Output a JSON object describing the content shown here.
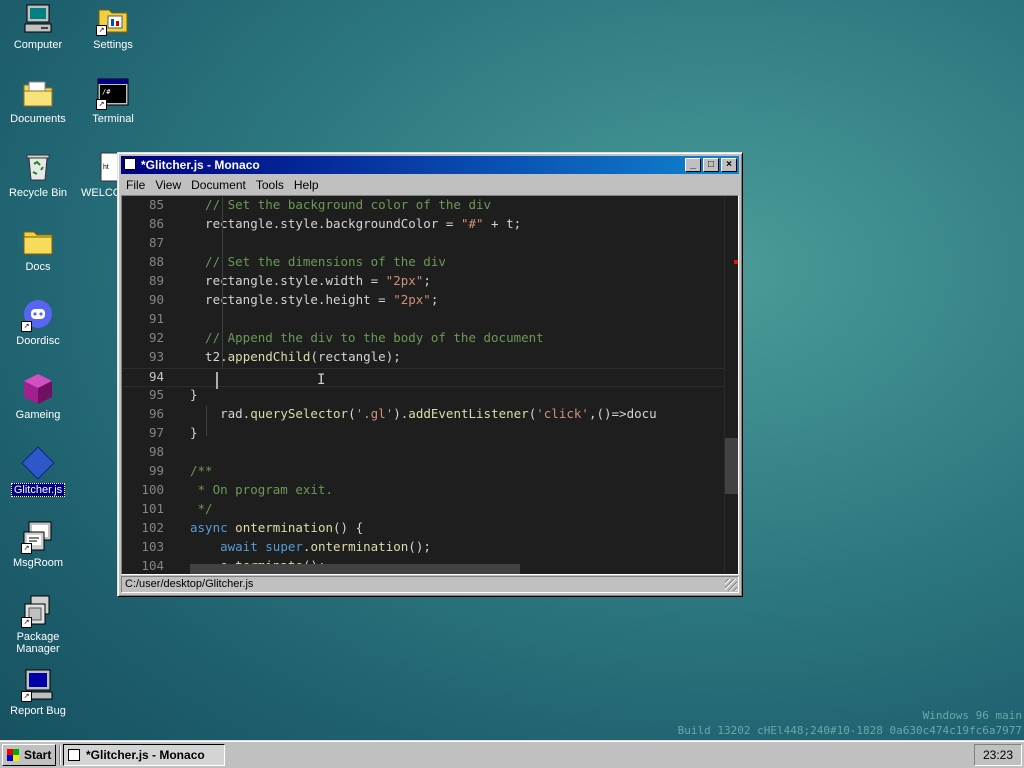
{
  "desktop": {
    "icons": [
      {
        "label": "Computer"
      },
      {
        "label": "Settings"
      },
      {
        "label": "Documents"
      },
      {
        "label": "Terminal"
      },
      {
        "label": "Recycle Bin"
      },
      {
        "label": "WELCO"
      },
      {
        "label": "Docs"
      },
      {
        "label": "Doordisc"
      },
      {
        "label": "Gameing"
      },
      {
        "label": "Glitcher.js"
      },
      {
        "label": "MsgRoom"
      },
      {
        "label": "Package Manager"
      },
      {
        "label": "Report Bug"
      }
    ]
  },
  "window": {
    "title": "*Glitcher.js - Monaco",
    "menu": [
      "File",
      "View",
      "Document",
      "Tools",
      "Help"
    ],
    "status_path": "C:/user/desktop/Glitcher.js",
    "controls": {
      "minimize": "_",
      "maximize": "□",
      "close": "×"
    }
  },
  "editor": {
    "current_line": "94",
    "lines": [
      {
        "n": "85",
        "text": "  // Set the background color of the div"
      },
      {
        "n": "86",
        "text": "  rectangle.style.backgroundColor = \"#\" + t;"
      },
      {
        "n": "87",
        "text": ""
      },
      {
        "n": "88",
        "text": "  // Set the dimensions of the div"
      },
      {
        "n": "89",
        "text": "  rectangle.style.width = \"2px\";"
      },
      {
        "n": "90",
        "text": "  rectangle.style.height = \"2px\";"
      },
      {
        "n": "91",
        "text": ""
      },
      {
        "n": "92",
        "text": "  // Append the div to the body of the document"
      },
      {
        "n": "93",
        "text": "  t2.appendChild(rectangle);"
      },
      {
        "n": "94",
        "text": ""
      },
      {
        "n": "95",
        "text": "}"
      },
      {
        "n": "96",
        "text": "    rad.querySelector('.gl').addEventListener('click',()=>docu"
      },
      {
        "n": "97",
        "text": "}"
      },
      {
        "n": "98",
        "text": ""
      },
      {
        "n": "99",
        "text": "/**"
      },
      {
        "n": "100",
        "text": " * On program exit."
      },
      {
        "n": "101",
        "text": " */"
      },
      {
        "n": "102",
        "text": "async ontermination() {"
      },
      {
        "n": "103",
        "text": "    await super.ontermination();"
      },
      {
        "n": "104",
        "text": "    e.terminate();"
      }
    ]
  },
  "watermark": {
    "line1": "Windows 96 main",
    "line2": "Build 13202 cHEl448;240#10-1828 0a630c474c19fc6a7977"
  },
  "taskbar": {
    "start_label": "Start",
    "task_label": "*Glitcher.js - Monaco",
    "clock": "23:23"
  },
  "colors": {
    "title_active": "#000080",
    "editor_bg": "#1e1e1e",
    "comment": "#6a9955",
    "string": "#ce9178",
    "keyword": "#569cd6"
  }
}
